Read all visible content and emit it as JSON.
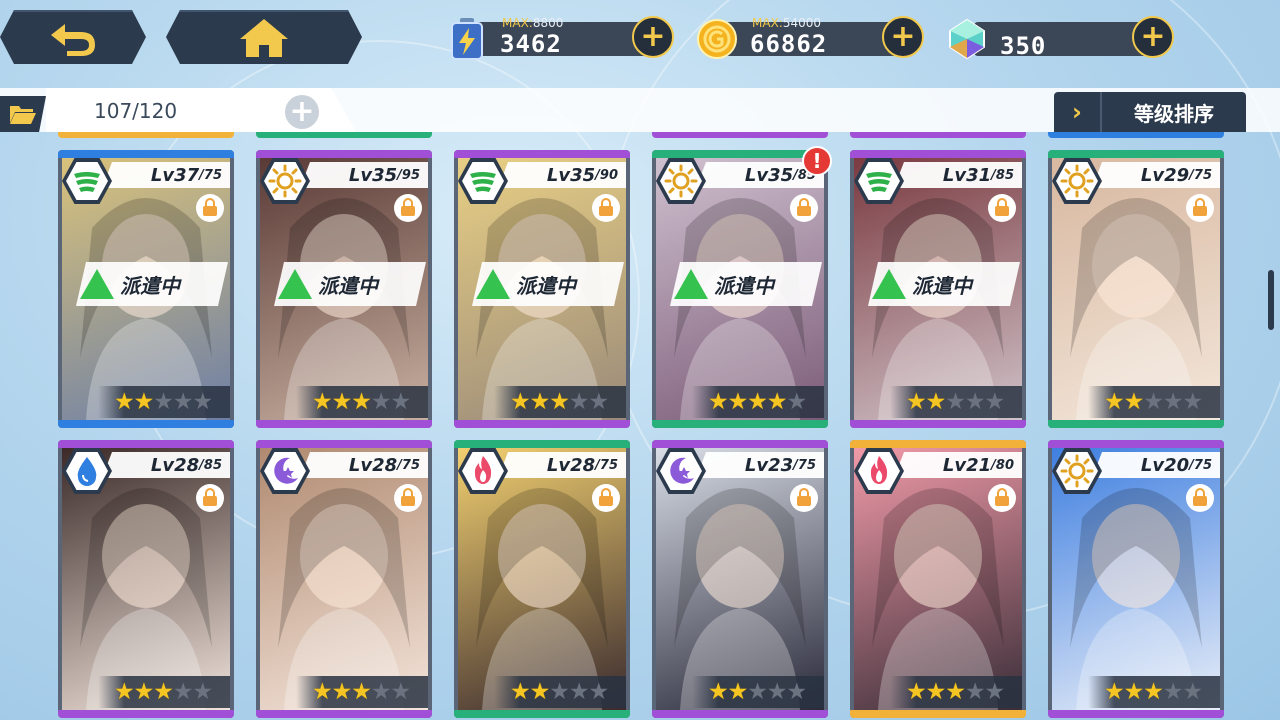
{
  "resources": [
    {
      "name": "stamina",
      "max_label": "MAX:",
      "max_value": "8800",
      "value": "3462",
      "icon": "battery-icon"
    },
    {
      "name": "gold",
      "max_label": "MAX:",
      "max_value": "54000",
      "value": "66862",
      "icon": "gold-coin-icon"
    },
    {
      "name": "gem",
      "value": "350",
      "icon": "crystal-icon"
    }
  ],
  "inventory": {
    "count": "107/120"
  },
  "sort": {
    "label": "等级排序"
  },
  "dispatch_label": "派遣中",
  "colors": {
    "blue": "#2f7fe0",
    "purple": "#a04fd6",
    "green": "#27b07a",
    "gold": "#f2b23a",
    "panel": "#2c3a4d",
    "star": "#f5c623"
  },
  "cards": [
    {
      "level": "Lv37",
      "max": "/75",
      "element": "wind",
      "rarity": "blue",
      "stars": 2,
      "dispatched": true,
      "alert": false
    },
    {
      "level": "Lv35",
      "max": "/95",
      "element": "light",
      "rarity": "purple",
      "stars": 3,
      "dispatched": true,
      "alert": false
    },
    {
      "level": "Lv35",
      "max": "/90",
      "element": "wind",
      "rarity": "purple",
      "stars": 3,
      "dispatched": true,
      "alert": false
    },
    {
      "level": "Lv35",
      "max": "/85",
      "element": "light",
      "rarity": "green",
      "stars": 4,
      "dispatched": true,
      "alert": true,
      "alert_text": "!"
    },
    {
      "level": "Lv31",
      "max": "/85",
      "element": "wind",
      "rarity": "purple",
      "stars": 2,
      "dispatched": true,
      "alert": false
    },
    {
      "level": "Lv29",
      "max": "/75",
      "element": "light",
      "rarity": "green",
      "stars": 2,
      "dispatched": false,
      "alert": false
    },
    {
      "level": "Lv28",
      "max": "/85",
      "element": "water",
      "rarity": "purple",
      "stars": 3,
      "dispatched": false,
      "alert": false
    },
    {
      "level": "Lv28",
      "max": "/75",
      "element": "dark",
      "rarity": "purple",
      "stars": 3,
      "dispatched": false,
      "alert": false
    },
    {
      "level": "Lv28",
      "max": "/75",
      "element": "fire",
      "rarity": "green",
      "stars": 2,
      "dispatched": false,
      "alert": false
    },
    {
      "level": "Lv23",
      "max": "/75",
      "element": "dark",
      "rarity": "purple",
      "stars": 2,
      "dispatched": false,
      "alert": false
    },
    {
      "level": "Lv21",
      "max": "/80",
      "element": "fire",
      "rarity": "gold",
      "stars": 3,
      "dispatched": false,
      "alert": false
    },
    {
      "level": "Lv20",
      "max": "/75",
      "element": "light",
      "rarity": "purple",
      "stars": 3,
      "dispatched": false,
      "alert": false
    }
  ]
}
